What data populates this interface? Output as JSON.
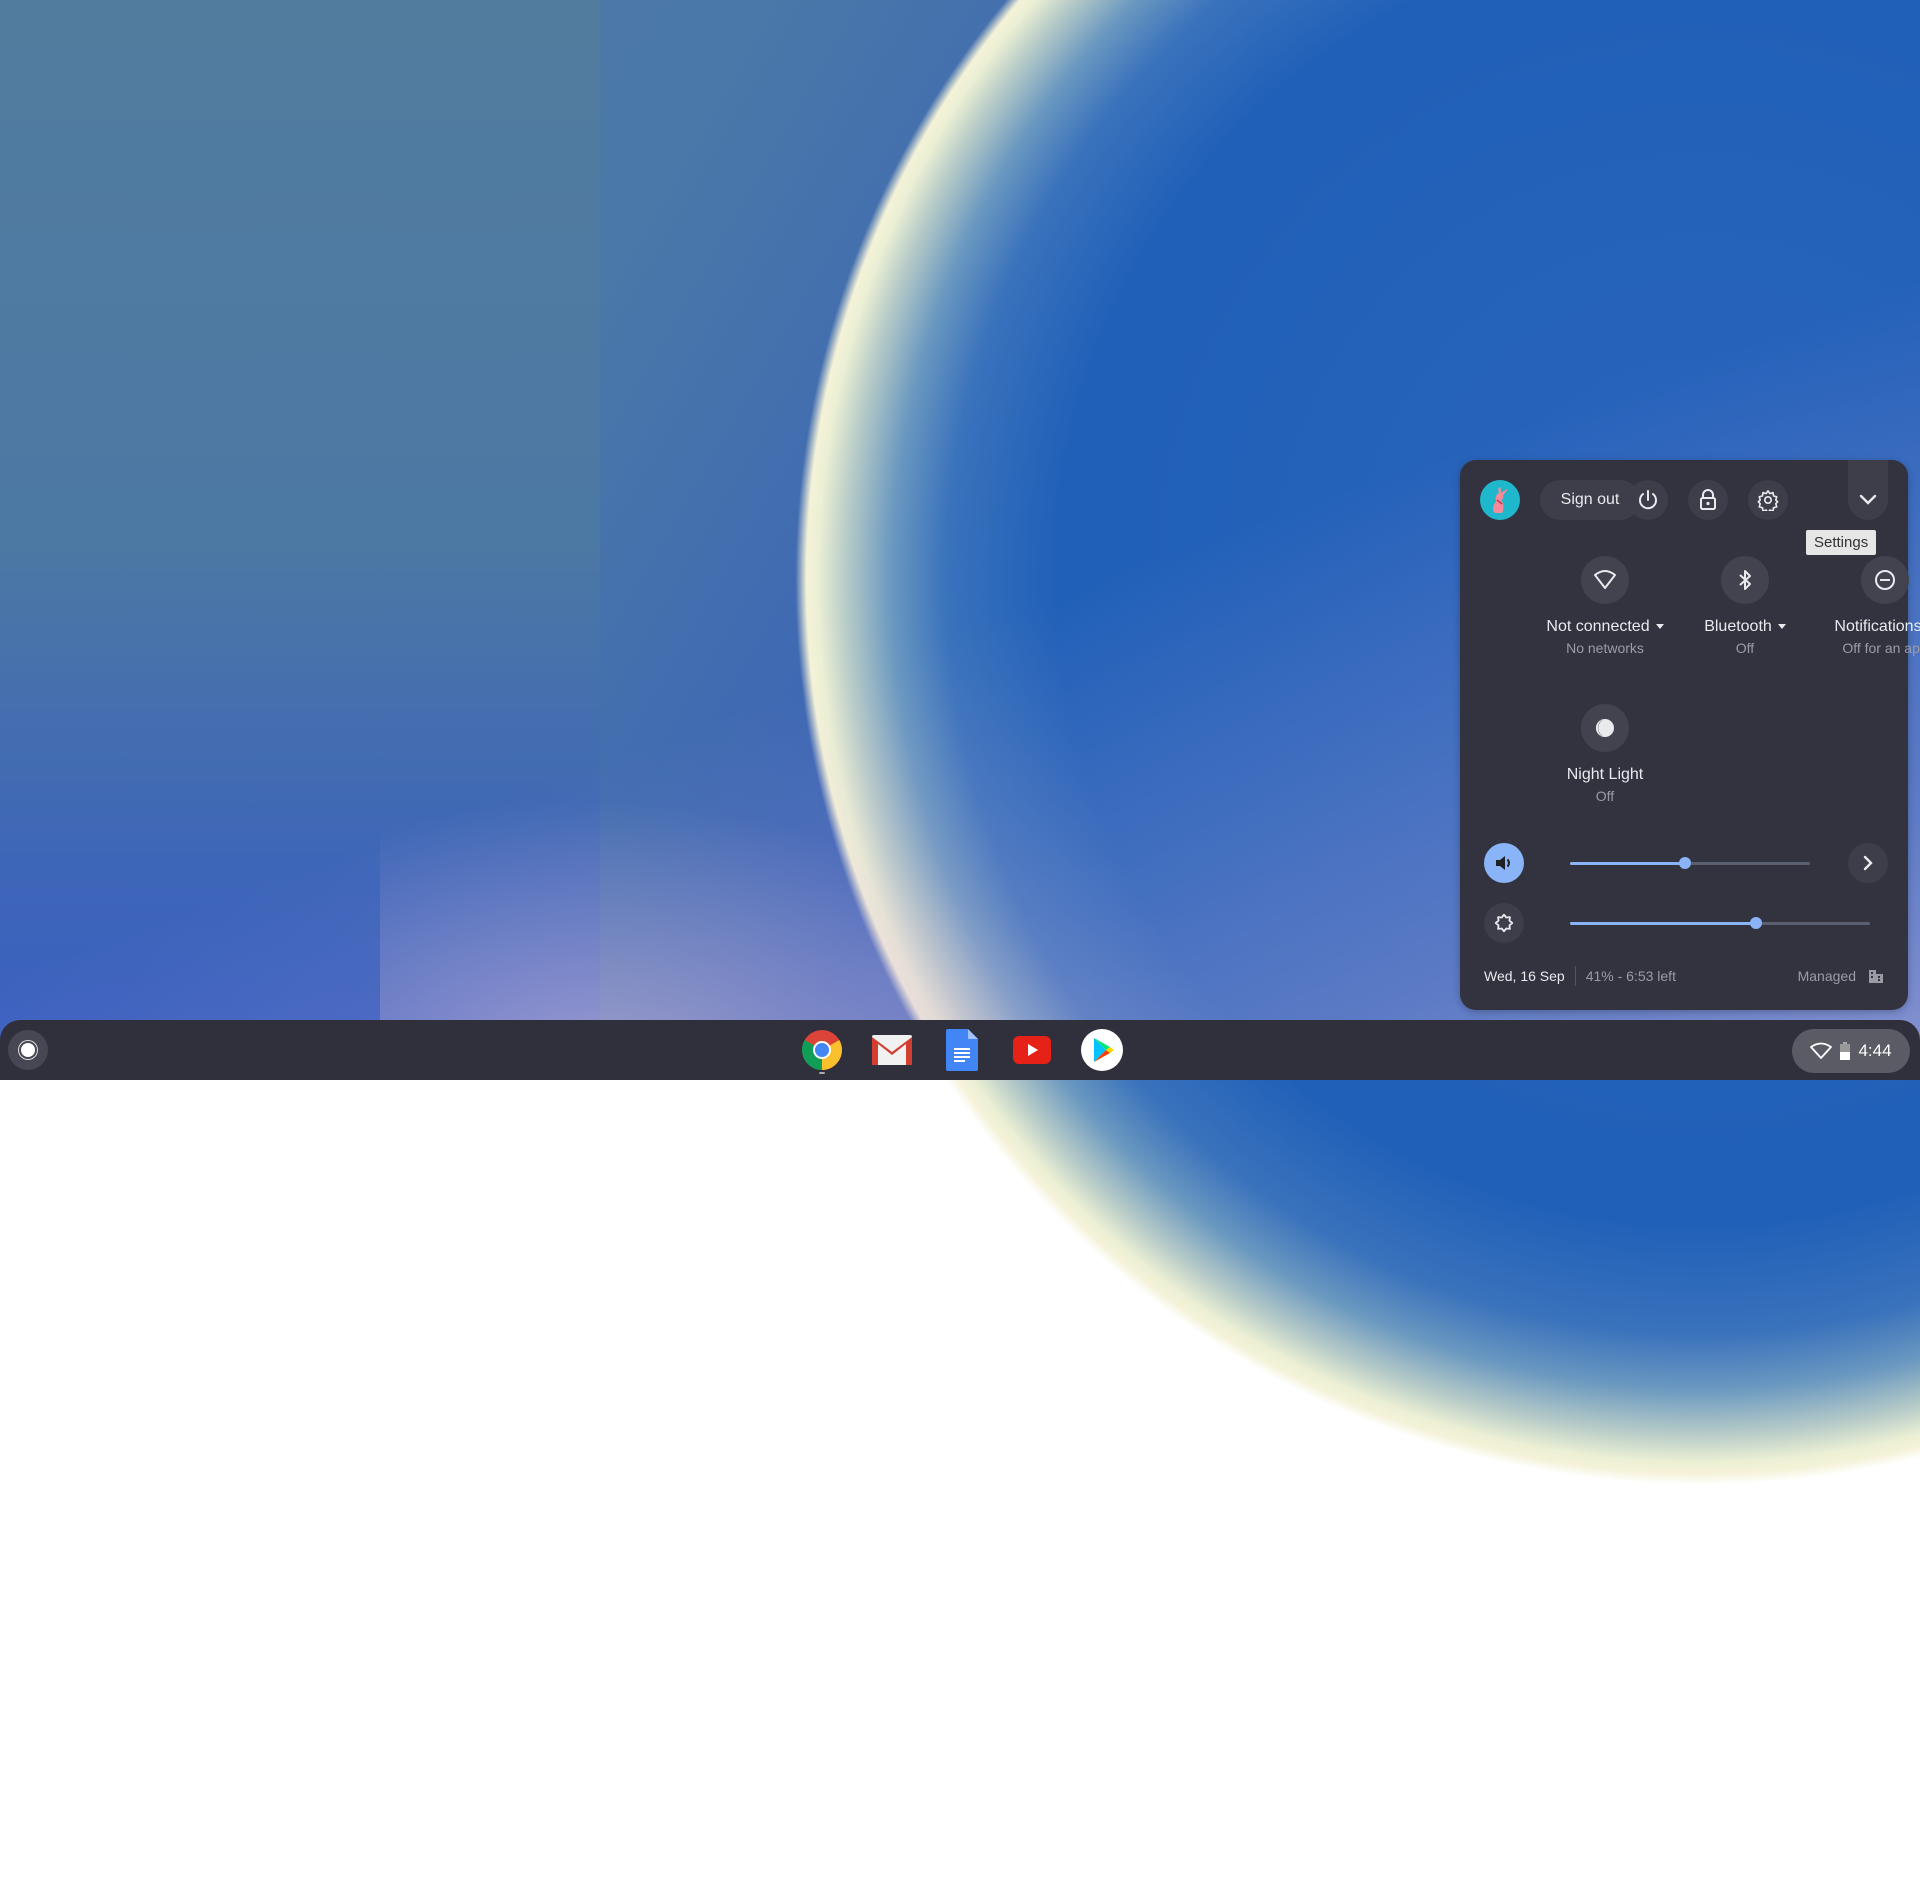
{
  "panel": {
    "sign_out_label": "Sign out",
    "avatar_icon": "rabbit-avatar",
    "power_icon": "power-icon",
    "lock_icon": "lock-icon",
    "settings_icon": "gear-icon",
    "collapse_icon": "chevron-down-icon",
    "tooltip": "Settings",
    "features": [
      {
        "icon": "wifi-icon",
        "label": "Not connected",
        "sublabel": "No networks",
        "has_menu": true
      },
      {
        "icon": "bluetooth-icon",
        "label": "Bluetooth",
        "sublabel": "Off",
        "has_menu": true
      },
      {
        "icon": "do-not-disturb-icon",
        "label": "Notifications",
        "sublabel": "Off for an app",
        "has_menu": true
      },
      {
        "icon": "night-light-icon",
        "label": "Night Light",
        "sublabel": "Off",
        "has_menu": false
      }
    ],
    "volume": {
      "icon": "volume-icon",
      "level_percent": 48,
      "active": true
    },
    "brightness": {
      "icon": "brightness-icon",
      "level_percent": 62
    },
    "footer": {
      "date": "Wed, 16 Sep",
      "battery": "41% - 6:53 left",
      "managed": "Managed",
      "managed_icon": "enterprise-building-icon"
    }
  },
  "shelf": {
    "launcher_icon": "launcher-icon",
    "apps": [
      {
        "name": "Chrome",
        "running": true
      },
      {
        "name": "Gmail",
        "running": false
      },
      {
        "name": "Docs",
        "running": false
      },
      {
        "name": "YouTube",
        "running": false
      },
      {
        "name": "Play Store",
        "running": false
      }
    ],
    "tray": {
      "time": "4:44",
      "wifi_icon": "wifi-icon",
      "battery_icon": "battery-icon"
    }
  },
  "colors": {
    "accent": "#8ab4f8",
    "panel_bg": "#32333f",
    "shelf_bg": "#2f303b"
  }
}
